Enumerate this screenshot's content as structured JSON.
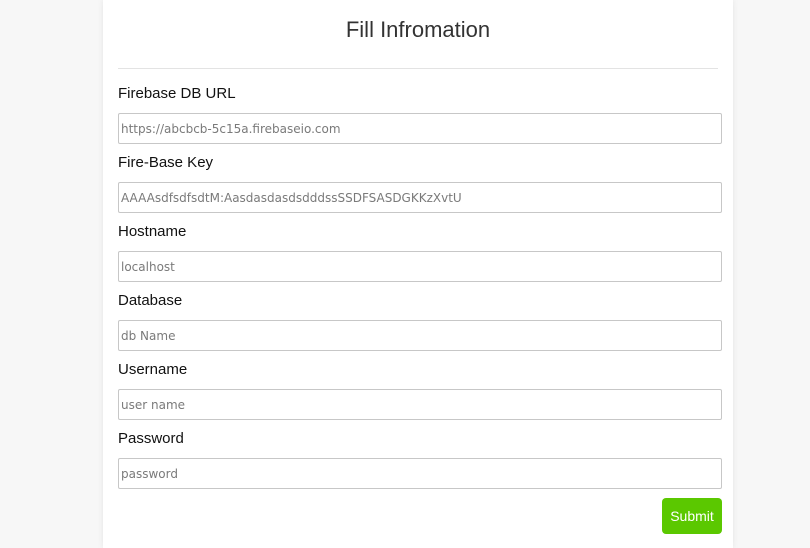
{
  "form": {
    "title": "Fill Infromation",
    "fields": [
      {
        "label": "Firebase DB URL",
        "placeholder": "https://abcbcb-5c15a.firebaseio.com"
      },
      {
        "label": "Fire-Base Key",
        "placeholder": "AAAAsdfsdfsdtM:AasdasdasdsdddssSSDFSASDGKKzXvtU"
      },
      {
        "label": "Hostname",
        "placeholder": "localhost"
      },
      {
        "label": "Database",
        "placeholder": "db Name"
      },
      {
        "label": "Username",
        "placeholder": "user name"
      },
      {
        "label": "Password",
        "placeholder": "password"
      }
    ],
    "submit_label": "Submit"
  },
  "colors": {
    "accent": "#5bc800",
    "background": "#f7f7f7",
    "card": "#ffffff"
  }
}
